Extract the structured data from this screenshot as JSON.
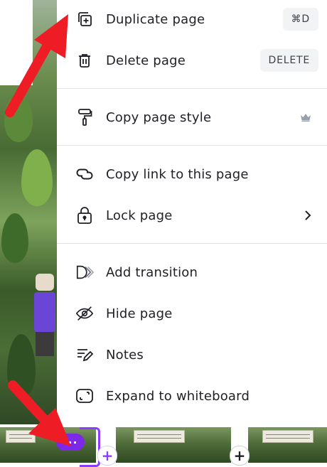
{
  "menu": {
    "items": [
      {
        "label": "Duplicate page",
        "icon": "duplicate-icon",
        "shortcut": "⌘D"
      },
      {
        "label": "Delete page",
        "icon": "trash-icon",
        "shortcut": "DELETE"
      },
      {
        "label": "Copy page style",
        "icon": "paint-roller-icon",
        "badge": "crown-icon"
      },
      {
        "label": "Copy link to this page",
        "icon": "link-icon"
      },
      {
        "label": "Lock page",
        "icon": "lock-icon",
        "trail": "chevron-right-icon"
      },
      {
        "label": "Add transition",
        "icon": "transition-icon"
      },
      {
        "label": "Hide page",
        "icon": "eye-slash-icon"
      },
      {
        "label": "Notes",
        "icon": "notes-icon"
      },
      {
        "label": "Expand to whiteboard",
        "icon": "whiteboard-icon"
      }
    ]
  },
  "page_strip": {
    "more_button": "···",
    "add_button": "+"
  },
  "colors": {
    "accent": "#8b3dff",
    "more_button": "#7d2ae8",
    "arrow": "#ee1c24",
    "text": "#1f1f26"
  }
}
